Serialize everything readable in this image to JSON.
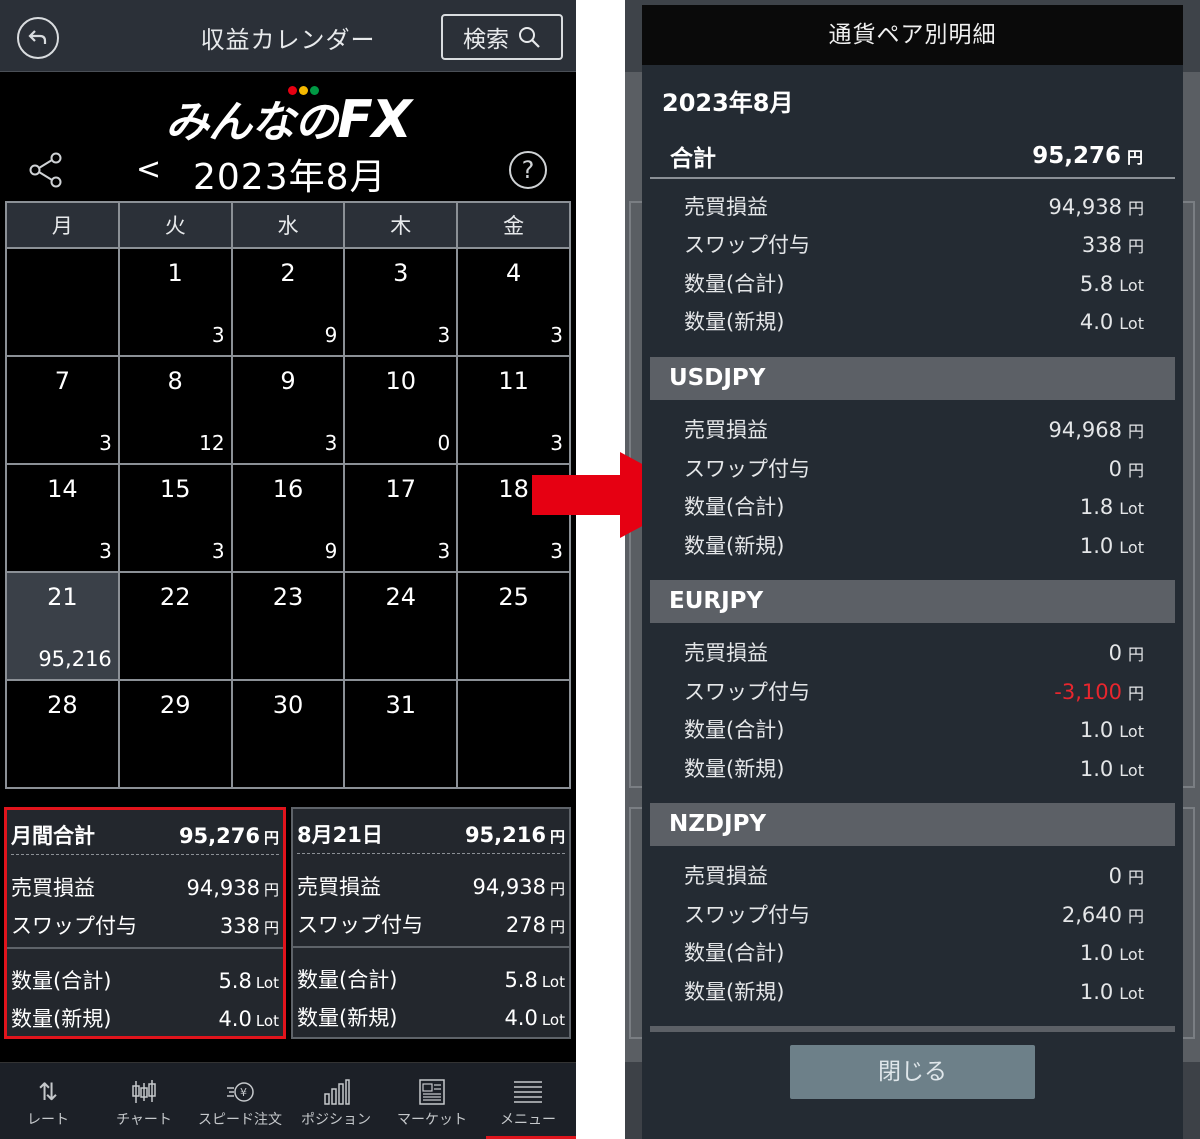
{
  "left": {
    "header": {
      "title": "収益カレンダー",
      "search_label": "検索"
    },
    "logo": {
      "text": "みんなの",
      "fx": "FX"
    },
    "calendar_nav": {
      "prev": "<",
      "month": "2023年8月",
      "help": "?"
    },
    "weekdays": [
      "月",
      "火",
      "水",
      "木",
      "金"
    ],
    "weeks": [
      [
        {
          "day": "",
          "count": ""
        },
        {
          "day": "1",
          "count": "3"
        },
        {
          "day": "2",
          "count": "9"
        },
        {
          "day": "3",
          "count": "3"
        },
        {
          "day": "4",
          "count": "3"
        }
      ],
      [
        {
          "day": "7",
          "count": "3"
        },
        {
          "day": "8",
          "count": "12"
        },
        {
          "day": "9",
          "count": "3"
        },
        {
          "day": "10",
          "count": "0"
        },
        {
          "day": "11",
          "count": "3"
        }
      ],
      [
        {
          "day": "14",
          "count": "3"
        },
        {
          "day": "15",
          "count": "3"
        },
        {
          "day": "16",
          "count": "9"
        },
        {
          "day": "17",
          "count": "3"
        },
        {
          "day": "18",
          "count": "3"
        }
      ],
      [
        {
          "day": "21",
          "count": "95,216"
        },
        {
          "day": "22",
          "count": ""
        },
        {
          "day": "23",
          "count": ""
        },
        {
          "day": "24",
          "count": ""
        },
        {
          "day": "25",
          "count": ""
        }
      ],
      [
        {
          "day": "28",
          "count": ""
        },
        {
          "day": "29",
          "count": ""
        },
        {
          "day": "30",
          "count": ""
        },
        {
          "day": "31",
          "count": ""
        },
        {
          "day": "",
          "count": ""
        }
      ]
    ],
    "monthly": {
      "title": "月間合計",
      "total": "95,276",
      "unit": "円",
      "rows": [
        {
          "label": "売買損益",
          "value": "94,938",
          "unit": "円"
        },
        {
          "label": "スワップ付与",
          "value": "338",
          "unit": "円"
        },
        {
          "label": "数量(合計)",
          "value": "5.8",
          "unit": "Lot"
        },
        {
          "label": "数量(新規)",
          "value": "4.0",
          "unit": "Lot"
        }
      ]
    },
    "daily": {
      "title": "8月21日",
      "total": "95,216",
      "unit": "円",
      "rows": [
        {
          "label": "売買損益",
          "value": "94,938",
          "unit": "円"
        },
        {
          "label": "スワップ付与",
          "value": "278",
          "unit": "円"
        },
        {
          "label": "数量(合計)",
          "value": "5.8",
          "unit": "Lot"
        },
        {
          "label": "数量(新規)",
          "value": "4.0",
          "unit": "Lot"
        }
      ]
    },
    "nav": [
      "レート",
      "チャート",
      "スピード注文",
      "ポジション",
      "マーケット",
      "メニュー"
    ]
  },
  "modal": {
    "title": "通貨ペア別明細",
    "month": "2023年8月",
    "total": {
      "label": "合計",
      "value": "95,276",
      "unit": "円"
    },
    "total_rows": [
      {
        "label": "売買損益",
        "value": "94,938",
        "unit": "円"
      },
      {
        "label": "スワップ付与",
        "value": "338",
        "unit": "円"
      },
      {
        "label": "数量(合計)",
        "value": "5.8",
        "unit": "Lot"
      },
      {
        "label": "数量(新規)",
        "value": "4.0",
        "unit": "Lot"
      }
    ],
    "pairs": [
      {
        "name": "USDJPY",
        "rows": [
          {
            "label": "売買損益",
            "value": "94,968",
            "unit": "円"
          },
          {
            "label": "スワップ付与",
            "value": "0",
            "unit": "円"
          },
          {
            "label": "数量(合計)",
            "value": "1.8",
            "unit": "Lot"
          },
          {
            "label": "数量(新規)",
            "value": "1.0",
            "unit": "Lot"
          }
        ]
      },
      {
        "name": "EURJPY",
        "rows": [
          {
            "label": "売買損益",
            "value": "0",
            "unit": "円"
          },
          {
            "label": "スワップ付与",
            "value": "-3,100",
            "unit": "円",
            "negative": true
          },
          {
            "label": "数量(合計)",
            "value": "1.0",
            "unit": "Lot"
          },
          {
            "label": "数量(新規)",
            "value": "1.0",
            "unit": "Lot"
          }
        ]
      },
      {
        "name": "NZDJPY",
        "rows": [
          {
            "label": "売買損益",
            "value": "0",
            "unit": "円"
          },
          {
            "label": "スワップ付与",
            "value": "2,640",
            "unit": "円"
          },
          {
            "label": "数量(合計)",
            "value": "1.0",
            "unit": "Lot"
          },
          {
            "label": "数量(新規)",
            "value": "1.0",
            "unit": "Lot"
          }
        ]
      }
    ],
    "close_label": "閉じる"
  },
  "colors": {
    "highlight": "#e0141c",
    "negative": "#e8262e",
    "logo_dots": [
      "#e60012",
      "#f5b800",
      "#009944"
    ]
  }
}
